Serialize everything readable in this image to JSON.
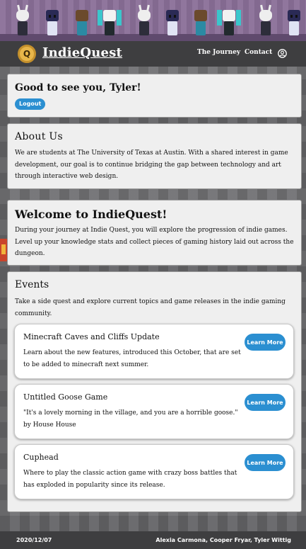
{
  "nav": {
    "brand": "IndieQuest",
    "links": [
      "The Journey",
      "Contact"
    ],
    "user_icon": "user-circle-icon",
    "logo_icon": "coin-logo-icon"
  },
  "greeting": {
    "text": "Good to see you, Tyler!",
    "logout_label": "Logout"
  },
  "about": {
    "title": "About Us",
    "body": "We are students at The University of Texas at Austin. With a shared interest in game development, our goal is to continue bridging the gap between technology and art through interactive web design."
  },
  "welcome": {
    "title": "Welcome to IndieQuest!",
    "body": "During your journey at Indie Quest, you will explore the progression of indie games. Level up your knowledge stats and collect pieces of gaming history laid out across the dungeon."
  },
  "events": {
    "title": "Events",
    "intro": "Take a side quest and explore current topics and game releases in the indie gaming community.",
    "items": [
      {
        "title": "Minecraft Caves and Cliffs Update",
        "description": "Learn about the new features, introduced this October, that are set to be added to minecraft next summer.",
        "button": "Learn More"
      },
      {
        "title": "Untitled Goose Game",
        "description": "\"It's a lovely morning in the village, and you are a horrible goose.\" by House House",
        "button": "Learn More"
      },
      {
        "title": "Cuphead",
        "description": "Where to play the classic action game with crazy boss battles that has exploded in popularity since its release.",
        "button": "Learn More"
      }
    ]
  },
  "footer": {
    "date": "2020/12/07",
    "authors": "Alexia Carmona, Cooper Fryar, Tyler Wittig"
  },
  "colors": {
    "accent": "#2b8fd1",
    "navbar": "#3e3e40",
    "card": "#efefef"
  }
}
